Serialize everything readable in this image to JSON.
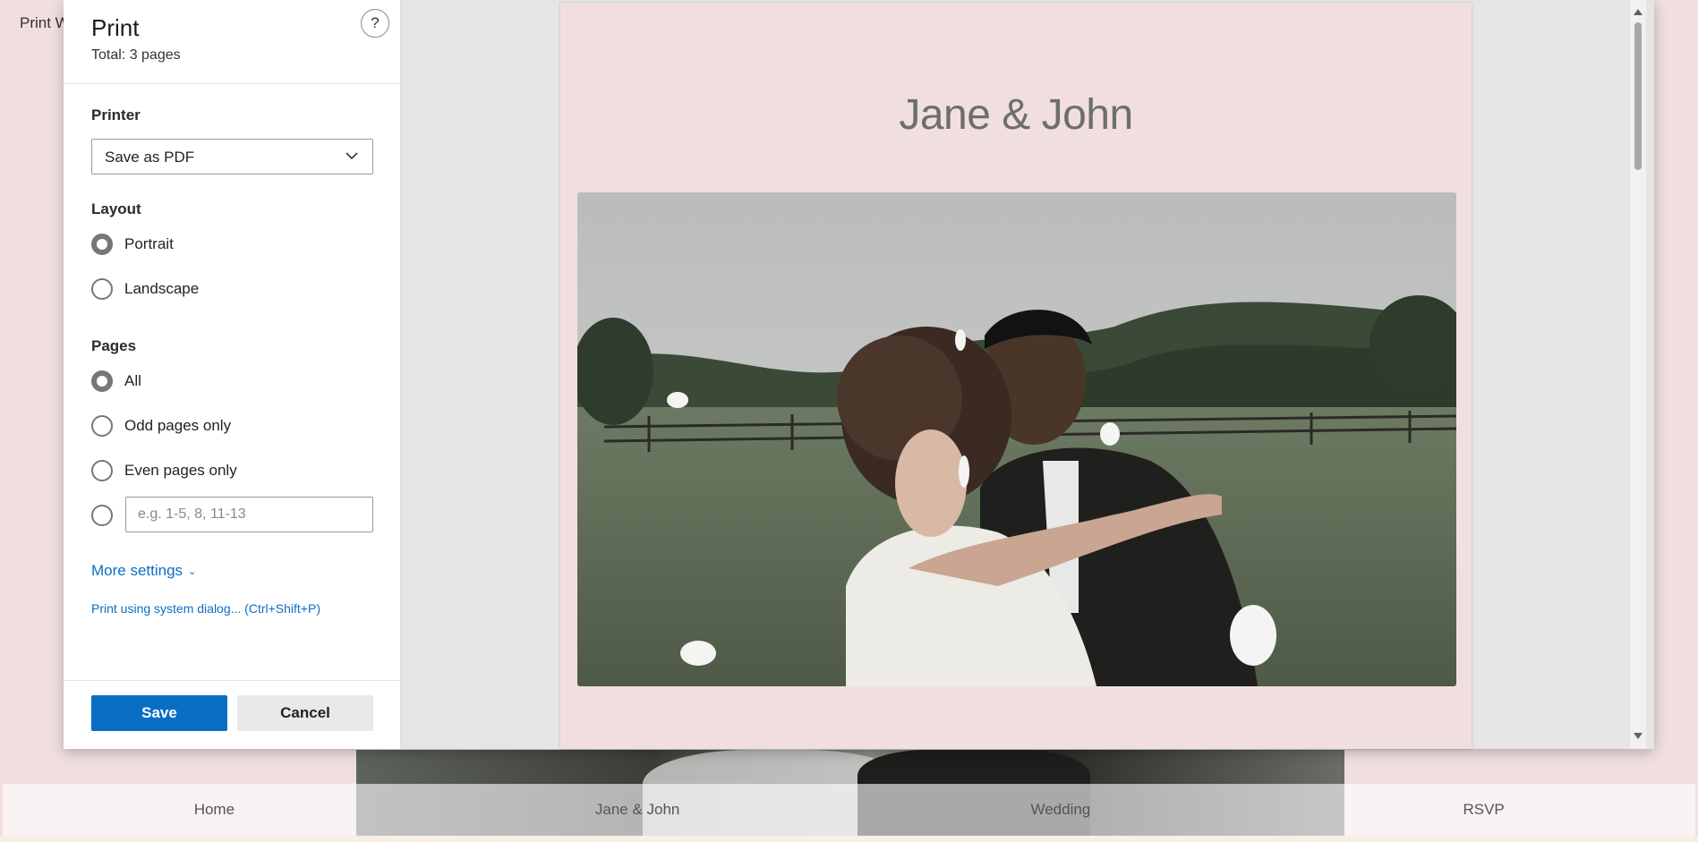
{
  "background": {
    "title_fragment": "Print W",
    "nav": [
      "Home",
      "Jane & John",
      "Wedding",
      "RSVP"
    ]
  },
  "dialog": {
    "title": "Print",
    "total": "Total: 3 pages",
    "help": "?",
    "printer": {
      "label": "Printer",
      "selected": "Save as PDF"
    },
    "layout": {
      "label": "Layout",
      "options": [
        "Portrait",
        "Landscape"
      ],
      "selected": "Portrait"
    },
    "pages": {
      "label": "Pages",
      "options": [
        "All",
        "Odd pages only",
        "Even pages only"
      ],
      "selected": "All",
      "custom_placeholder": "e.g. 1-5, 8, 11-13"
    },
    "more_settings": "More settings",
    "system_dialog": "Print using system dialog... (Ctrl+Shift+P)",
    "save": "Save",
    "cancel": "Cancel"
  },
  "preview": {
    "heading": "Jane & John",
    "image_alt": "Couple kissing in a grassy field with hills and a wooden fence"
  }
}
